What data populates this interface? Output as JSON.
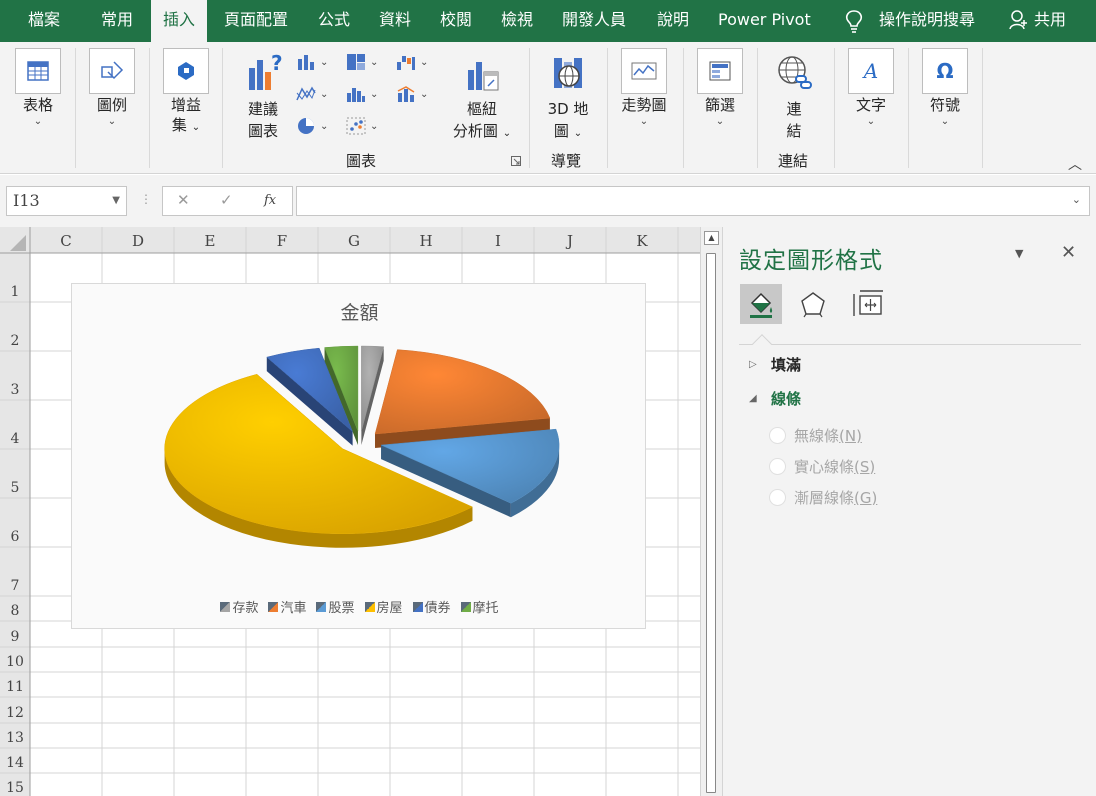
{
  "tabs": [
    {
      "label": "檔案",
      "active": false
    },
    {
      "label": "常用",
      "active": false
    },
    {
      "label": "插入",
      "active": true
    },
    {
      "label": "頁面配置",
      "active": false
    },
    {
      "label": "公式",
      "active": false
    },
    {
      "label": "資料",
      "active": false
    },
    {
      "label": "校閱",
      "active": false
    },
    {
      "label": "檢視",
      "active": false
    },
    {
      "label": "開發人員",
      "active": false
    },
    {
      "label": "說明",
      "active": false
    },
    {
      "label": "Power Pivot",
      "active": false
    }
  ],
  "tell_me": "操作說明搜尋",
  "share": "共用",
  "ribbon": {
    "table": "表格",
    "illustrations": "圖例",
    "addins_line1": "增益",
    "addins_line2": "集",
    "recommended_line1": "建議",
    "recommended_line2": "圖表",
    "pivotchart_line1": "樞紐",
    "pivotchart_line2": "分析圖",
    "map3d_line1": "3D 地",
    "map3d_line2": "圖",
    "sparklines": "走勢圖",
    "filters": "篩選",
    "link_line1": "連",
    "link_line2": "結",
    "text": "文字",
    "symbols": "符號",
    "group_charts": "圖表",
    "group_tours": "導覽",
    "group_links": "連結"
  },
  "formula_bar": {
    "name_box": "I13",
    "fx": "fx",
    "cancel": "✕",
    "enter": "✓",
    "value": ""
  },
  "sheet": {
    "columns": [
      "C",
      "D",
      "E",
      "F",
      "G",
      "H",
      "I",
      "J",
      "K"
    ],
    "rows": [
      "1",
      "2",
      "3",
      "4",
      "5",
      "6",
      "7",
      "8",
      "9",
      "10",
      "11",
      "12",
      "13",
      "14",
      "15"
    ]
  },
  "chart_data": {
    "type": "pie",
    "title": "金額",
    "exploded": true,
    "three_d": true,
    "legend_position": "bottom",
    "categories": [
      "存款",
      "汽車",
      "股票",
      "房屋",
      "債券",
      "摩托"
    ],
    "values": [
      2,
      20,
      15,
      55,
      5,
      3
    ],
    "colors": [
      "#a5a5a5",
      "#ed7d31",
      "#5b9bd5",
      "#ffc000",
      "#4472c4",
      "#70ad47"
    ]
  },
  "format_pane": {
    "title": "設定圖形格式",
    "sections": {
      "fill": "填滿",
      "line": "線條"
    },
    "options": [
      {
        "label": "無線條",
        "key": "(N)"
      },
      {
        "label": "實心線條",
        "key": "(S)"
      },
      {
        "label": "漸層線條",
        "key": "(G)"
      }
    ],
    "tab_icons": [
      "fill-line-icon",
      "effects-icon",
      "size-properties-icon"
    ]
  }
}
